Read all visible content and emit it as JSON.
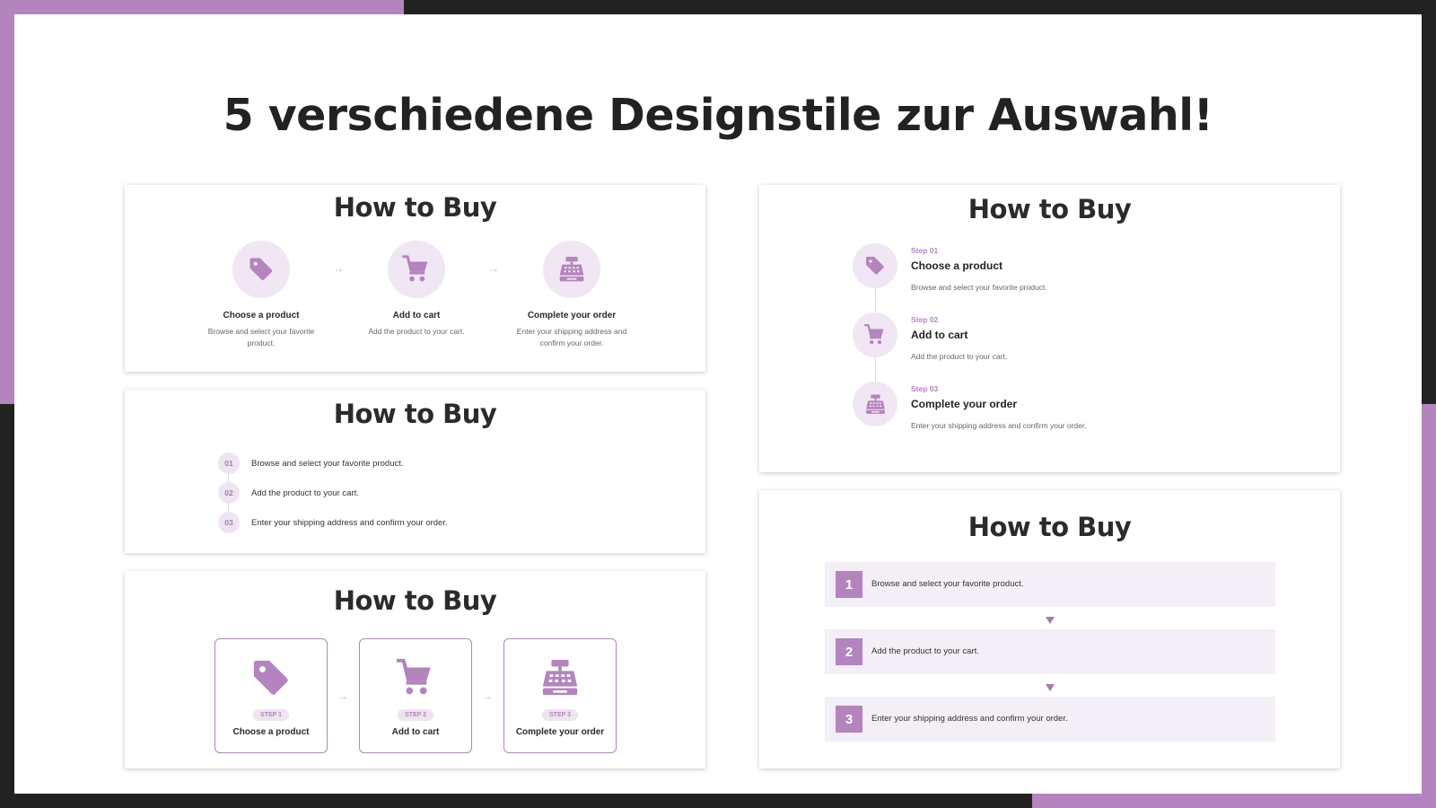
{
  "main_title": "5 verschiedene Designstile zur Auswahl!",
  "colors": {
    "accent": "#b384bd",
    "accent_light": "#f1e6f3",
    "dark_frame": "#222222"
  },
  "cards": {
    "c1": {
      "title": "How to Buy",
      "steps": [
        {
          "icon": "tag-icon",
          "title": "Choose a product",
          "desc": "Browse and select your favorite product."
        },
        {
          "icon": "cart-icon",
          "title": "Add to cart",
          "desc": "Add the product to your cart."
        },
        {
          "icon": "cash-register-icon",
          "title": "Complete your order",
          "desc": "Enter your shipping address and confirm your order."
        }
      ],
      "arrow": "→"
    },
    "c2": {
      "title": "How to Buy",
      "steps": [
        {
          "num": "01",
          "text": "Browse and select your favorite product."
        },
        {
          "num": "02",
          "text": "Add the product to your cart."
        },
        {
          "num": "03",
          "text": "Enter your shipping address and confirm your order."
        }
      ]
    },
    "c3": {
      "title": "How to Buy",
      "steps": [
        {
          "icon": "tag-icon",
          "label": "STEP 1",
          "title": "Choose a product"
        },
        {
          "icon": "cart-icon",
          "label": "STEP 2",
          "title": "Add to cart"
        },
        {
          "icon": "cash-register-icon",
          "label": "STEP 3",
          "title": "Complete your order"
        }
      ],
      "arrow": "→"
    },
    "c4": {
      "title": "How to Buy",
      "steps": [
        {
          "icon": "tag-icon",
          "label": "Step 01",
          "title": "Choose a product",
          "desc": "Browse and select your favorite product."
        },
        {
          "icon": "cart-icon",
          "label": "Step 02",
          "title": "Add to cart",
          "desc": "Add the product to your cart."
        },
        {
          "icon": "cash-register-icon",
          "label": "Step 03",
          "title": "Complete your order",
          "desc": "Enter your shipping address and confirm your order."
        }
      ]
    },
    "c5": {
      "title": "How to Buy",
      "steps": [
        {
          "num": "1",
          "text": "Browse and select your favorite product."
        },
        {
          "num": "2",
          "text": "Add the product to your cart."
        },
        {
          "num": "3",
          "text": "Enter your shipping address and confirm your order."
        }
      ]
    }
  }
}
